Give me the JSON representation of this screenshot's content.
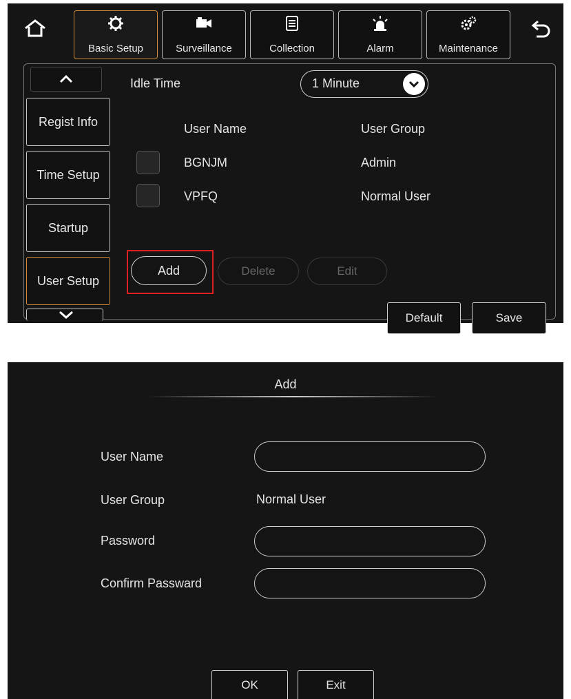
{
  "top_nav": {
    "tabs": [
      {
        "label": "Basic Setup",
        "icon": "gear-icon",
        "active": true
      },
      {
        "label": "Surveillance",
        "icon": "camera-icon",
        "active": false
      },
      {
        "label": "Collection",
        "icon": "document-icon",
        "active": false
      },
      {
        "label": "Alarm",
        "icon": "alarm-light-icon",
        "active": false
      },
      {
        "label": "Maintenance",
        "icon": "gears-icon",
        "active": false
      }
    ]
  },
  "sidebar": {
    "items": [
      {
        "label": "Regist Info"
      },
      {
        "label": "Time Setup"
      },
      {
        "label": "Startup"
      },
      {
        "label": "User Setup",
        "active": true
      }
    ]
  },
  "user_setup": {
    "idle_time_label": "Idle Time",
    "idle_time_value": "1 Minute",
    "columns": [
      "User Name",
      "User Group"
    ],
    "rows": [
      {
        "name": "BGNJM",
        "group": "Admin"
      },
      {
        "name": "VPFQ",
        "group": "Normal User"
      }
    ],
    "add_label": "Add",
    "delete_label": "Delete",
    "edit_label": "Edit",
    "default_label": "Default",
    "save_label": "Save"
  },
  "add_dialog": {
    "title": "Add",
    "user_name_label": "User Name",
    "user_name_value": "",
    "user_group_label": "User Group",
    "user_group_value": "Normal User",
    "password_label": "Password",
    "password_value": "",
    "confirm_label": "Confirm Passward",
    "confirm_value": "",
    "ok_label": "OK",
    "exit_label": "Exit"
  },
  "colors": {
    "panel_bg": "#151515",
    "active_accent": "#d08a3a",
    "highlight_red": "#e02020"
  }
}
